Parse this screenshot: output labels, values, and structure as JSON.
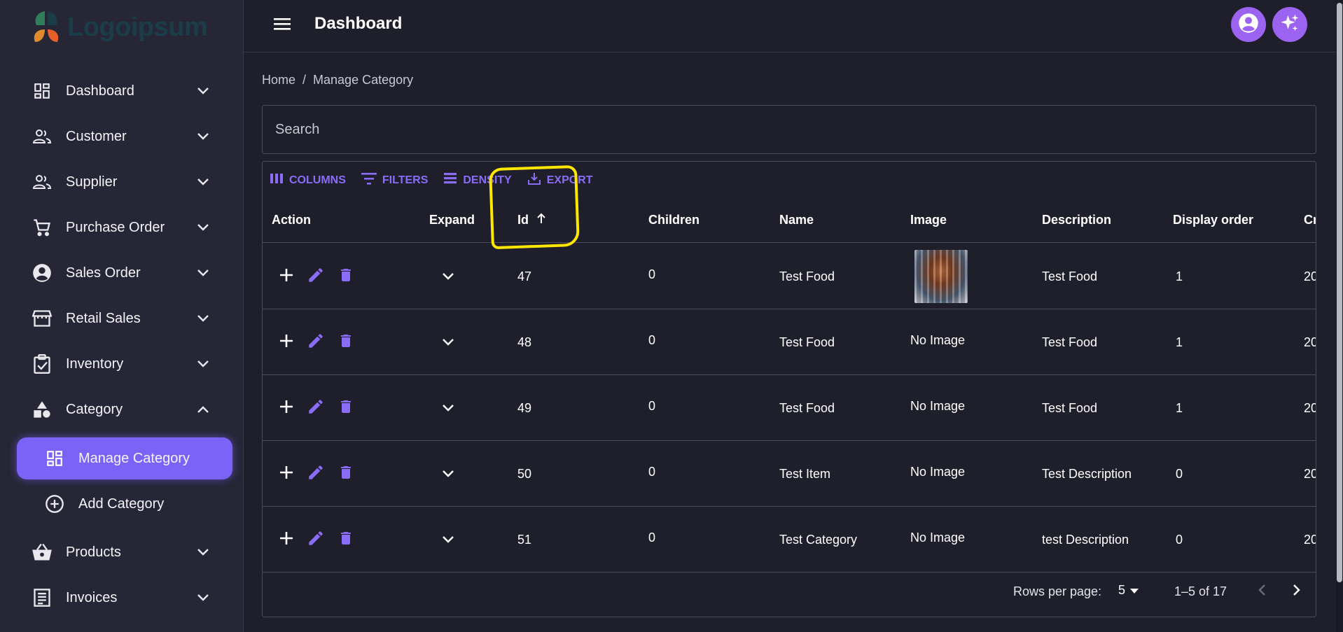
{
  "app": {
    "logo_text": "Logoipsum",
    "page_title": "Dashboard"
  },
  "sidebar": {
    "items": [
      {
        "label": "Dashboard",
        "icon": "dashboard-icon",
        "expanded": false
      },
      {
        "label": "Customer",
        "icon": "people-icon",
        "expanded": false
      },
      {
        "label": "Supplier",
        "icon": "people-icon",
        "expanded": false
      },
      {
        "label": "Purchase Order",
        "icon": "cart-icon",
        "expanded": false
      },
      {
        "label": "Sales Order",
        "icon": "account-circle-icon",
        "expanded": false
      },
      {
        "label": "Retail Sales",
        "icon": "store-icon",
        "expanded": false
      },
      {
        "label": "Inventory",
        "icon": "clipboard-check-icon",
        "expanded": false
      },
      {
        "label": "Category",
        "icon": "category-shapes-icon",
        "expanded": true
      },
      {
        "label": "Products",
        "icon": "basket-icon",
        "expanded": false
      },
      {
        "label": "Invoices",
        "icon": "receipt-icon",
        "expanded": false
      }
    ],
    "category_sub": [
      {
        "label": "Manage Category",
        "icon": "dashboard-icon",
        "active": true
      },
      {
        "label": "Add Category",
        "icon": "add-circle-icon",
        "active": false
      }
    ]
  },
  "breadcrumb": {
    "home": "Home",
    "separator": "/",
    "current": "Manage Category"
  },
  "search": {
    "placeholder": "Search"
  },
  "toolbar": {
    "columns": "COLUMNS",
    "filters": "FILTERS",
    "density": "DENSITY",
    "export": "EXPORT"
  },
  "table": {
    "headers": {
      "action": "Action",
      "expand": "Expand",
      "id": "Id",
      "children": "Children",
      "name": "Name",
      "image": "Image",
      "description": "Description",
      "display_order": "Display order",
      "created": "Cr"
    },
    "sort": {
      "column": "Id",
      "direction": "ascending"
    },
    "rows": [
      {
        "id": "47",
        "children": "0",
        "name": "Test Food",
        "image": "",
        "has_image": true,
        "description": "Test Food",
        "display_order": "1",
        "created": "20"
      },
      {
        "id": "48",
        "children": "0",
        "name": "Test Food",
        "image": "No Image",
        "has_image": false,
        "description": "Test Food",
        "display_order": "1",
        "created": "20"
      },
      {
        "id": "49",
        "children": "0",
        "name": "Test Food",
        "image": "No Image",
        "has_image": false,
        "description": "Test Food",
        "display_order": "1",
        "created": "20"
      },
      {
        "id": "50",
        "children": "0",
        "name": "Test Item",
        "image": "No Image",
        "has_image": false,
        "description": "Test Description",
        "display_order": "0",
        "created": "20"
      },
      {
        "id": "51",
        "children": "0",
        "name": "Test Category",
        "image": "No Image",
        "has_image": false,
        "description": "test Description",
        "display_order": "0",
        "created": "20"
      }
    ]
  },
  "pagination": {
    "rows_per_page_label": "Rows per page:",
    "rows_per_page": "5",
    "range": "1–5 of 17"
  },
  "colors": {
    "accent": "#7a63f6",
    "icon_purple": "#9b63f0",
    "highlight": "#ffe600",
    "background": "#1f1f2c",
    "sidebar": "#262636"
  }
}
